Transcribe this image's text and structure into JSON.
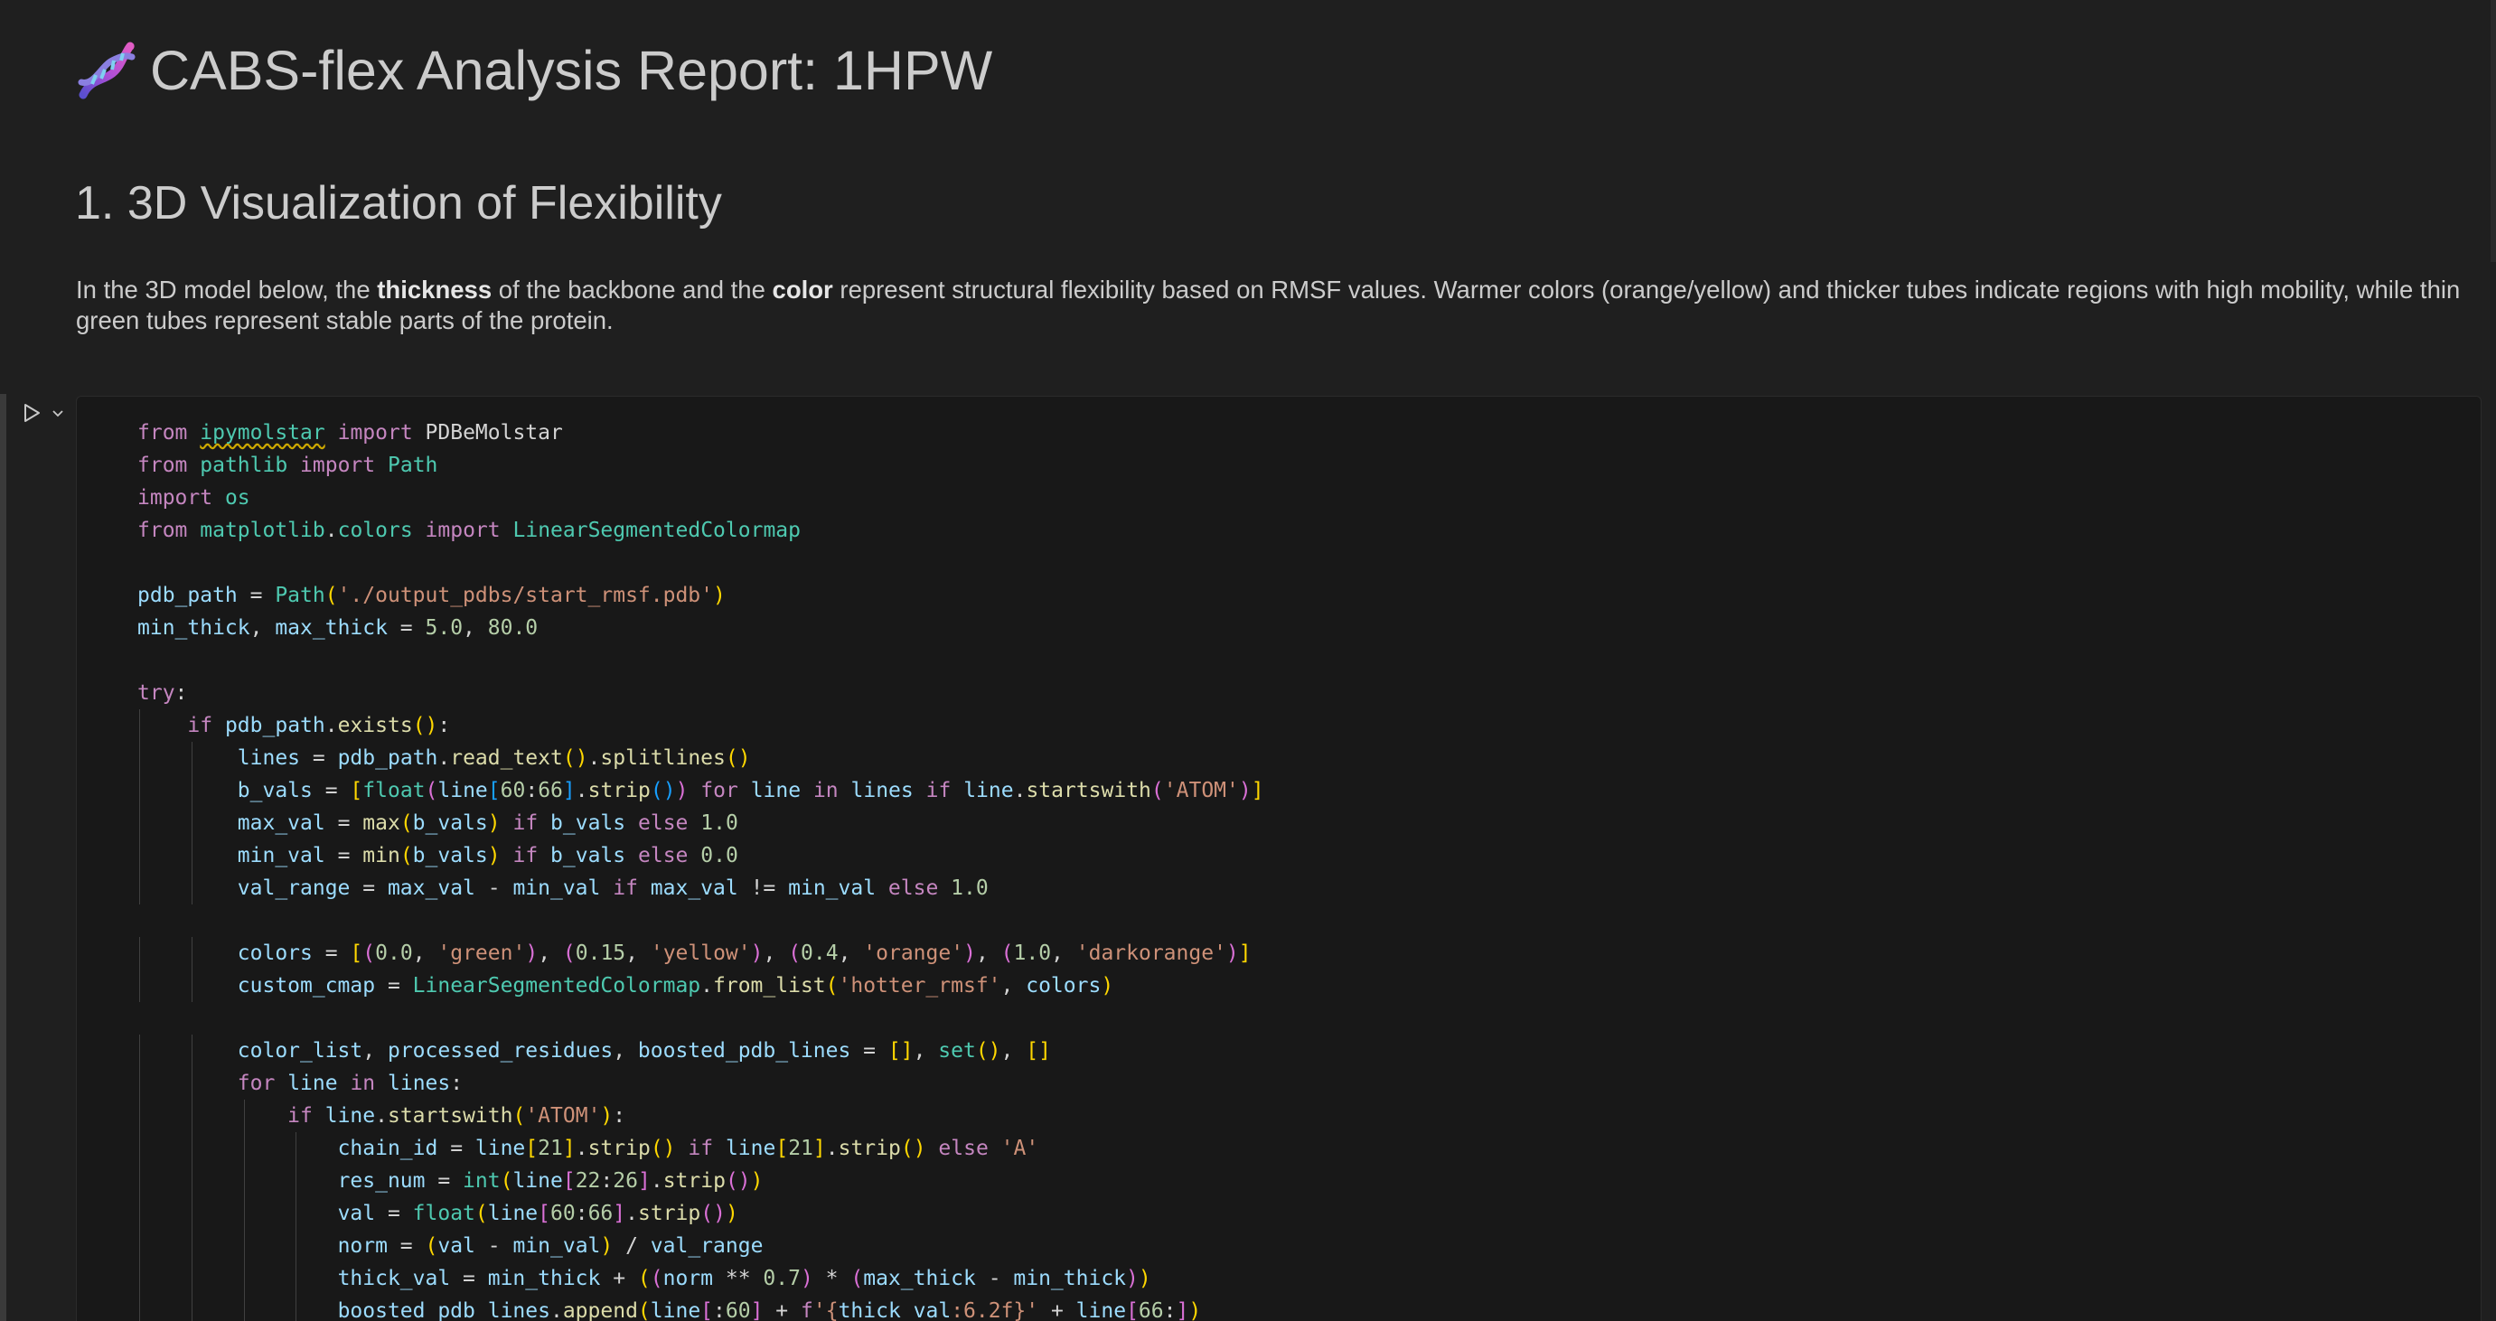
{
  "report": {
    "title": "CABS-flex Analysis Report: 1HPW",
    "title_icon": "dna-icon"
  },
  "section": {
    "title": "1. 3D Visualization of Flexibility",
    "paragraph": {
      "p1": "In the 3D model below, the ",
      "b1": "thickness",
      "p2": " of the backbone and the ",
      "b2": "color",
      "p3": " represent structural flexibility based on RMSF values. Warmer colors (orange/yellow) and thicker tubes indicate regions with high mobility, while thin green tubes represent stable parts of the protein."
    }
  },
  "cell": {
    "run_icon": "run-cell-icon",
    "expand_icon": "chevron-down-icon",
    "code_lines": [
      [
        [
          "kw",
          "from"
        ],
        [
          "op",
          " "
        ],
        [
          "mod sq",
          "ipymolstar"
        ],
        [
          "op",
          " "
        ],
        [
          "kw",
          "import"
        ],
        [
          "op",
          " PDBeMolstar"
        ]
      ],
      [
        [
          "kw",
          "from"
        ],
        [
          "op",
          " "
        ],
        [
          "mod",
          "pathlib"
        ],
        [
          "op",
          " "
        ],
        [
          "kw",
          "import"
        ],
        [
          "op",
          " "
        ],
        [
          "mod",
          "Path"
        ]
      ],
      [
        [
          "kw",
          "import"
        ],
        [
          "op",
          " "
        ],
        [
          "mod",
          "os"
        ]
      ],
      [
        [
          "kw",
          "from"
        ],
        [
          "op",
          " "
        ],
        [
          "mod",
          "matplotlib"
        ],
        [
          "op",
          "."
        ],
        [
          "mod",
          "colors"
        ],
        [
          "op",
          " "
        ],
        [
          "kw",
          "import"
        ],
        [
          "op",
          " "
        ],
        [
          "mod",
          "LinearSegmentedColormap"
        ]
      ],
      [],
      [
        [
          "var",
          "pdb_path"
        ],
        [
          "op",
          " = "
        ],
        [
          "mod",
          "Path"
        ],
        [
          "br1",
          "("
        ],
        [
          "str",
          "'./output_pdbs/start_rmsf.pdb'"
        ],
        [
          "br1",
          ")"
        ]
      ],
      [
        [
          "var",
          "min_thick"
        ],
        [
          "op",
          ", "
        ],
        [
          "var",
          "max_thick"
        ],
        [
          "op",
          " = "
        ],
        [
          "num",
          "5.0"
        ],
        [
          "op",
          ", "
        ],
        [
          "num",
          "80.0"
        ]
      ],
      [],
      [
        [
          "kw",
          "try"
        ],
        [
          "op",
          ":"
        ]
      ],
      [
        [
          "op",
          "    "
        ],
        [
          "kw",
          "if"
        ],
        [
          "op",
          " "
        ],
        [
          "var",
          "pdb_path"
        ],
        [
          "op",
          "."
        ],
        [
          "fn",
          "exists"
        ],
        [
          "br1",
          "()"
        ],
        [
          "op",
          ":"
        ]
      ],
      [
        [
          "op",
          "        "
        ],
        [
          "var",
          "lines"
        ],
        [
          "op",
          " = "
        ],
        [
          "var",
          "pdb_path"
        ],
        [
          "op",
          "."
        ],
        [
          "fn",
          "read_text"
        ],
        [
          "br1",
          "()"
        ],
        [
          "op",
          "."
        ],
        [
          "fn",
          "splitlines"
        ],
        [
          "br1",
          "()"
        ]
      ],
      [
        [
          "op",
          "        "
        ],
        [
          "var",
          "b_vals"
        ],
        [
          "op",
          " = "
        ],
        [
          "br1",
          "["
        ],
        [
          "mod",
          "float"
        ],
        [
          "br2",
          "("
        ],
        [
          "var",
          "line"
        ],
        [
          "br3",
          "["
        ],
        [
          "num",
          "60"
        ],
        [
          "op",
          ":"
        ],
        [
          "num",
          "66"
        ],
        [
          "br3",
          "]"
        ],
        [
          "op",
          "."
        ],
        [
          "fn",
          "strip"
        ],
        [
          "br3",
          "()"
        ],
        [
          "br2",
          ")"
        ],
        [
          "op",
          " "
        ],
        [
          "kw",
          "for"
        ],
        [
          "op",
          " "
        ],
        [
          "var",
          "line"
        ],
        [
          "op",
          " "
        ],
        [
          "kw",
          "in"
        ],
        [
          "op",
          " "
        ],
        [
          "var",
          "lines"
        ],
        [
          "op",
          " "
        ],
        [
          "kw",
          "if"
        ],
        [
          "op",
          " "
        ],
        [
          "var",
          "line"
        ],
        [
          "op",
          "."
        ],
        [
          "fn",
          "startswith"
        ],
        [
          "br2",
          "("
        ],
        [
          "str",
          "'ATOM'"
        ],
        [
          "br2",
          ")"
        ],
        [
          "br1",
          "]"
        ]
      ],
      [
        [
          "op",
          "        "
        ],
        [
          "var",
          "max_val"
        ],
        [
          "op",
          " = "
        ],
        [
          "fn",
          "max"
        ],
        [
          "br1",
          "("
        ],
        [
          "var",
          "b_vals"
        ],
        [
          "br1",
          ")"
        ],
        [
          "op",
          " "
        ],
        [
          "kw",
          "if"
        ],
        [
          "op",
          " "
        ],
        [
          "var",
          "b_vals"
        ],
        [
          "op",
          " "
        ],
        [
          "kw",
          "else"
        ],
        [
          "op",
          " "
        ],
        [
          "num",
          "1.0"
        ]
      ],
      [
        [
          "op",
          "        "
        ],
        [
          "var",
          "min_val"
        ],
        [
          "op",
          " = "
        ],
        [
          "fn",
          "min"
        ],
        [
          "br1",
          "("
        ],
        [
          "var",
          "b_vals"
        ],
        [
          "br1",
          ")"
        ],
        [
          "op",
          " "
        ],
        [
          "kw",
          "if"
        ],
        [
          "op",
          " "
        ],
        [
          "var",
          "b_vals"
        ],
        [
          "op",
          " "
        ],
        [
          "kw",
          "else"
        ],
        [
          "op",
          " "
        ],
        [
          "num",
          "0.0"
        ]
      ],
      [
        [
          "op",
          "        "
        ],
        [
          "var",
          "val_range"
        ],
        [
          "op",
          " = "
        ],
        [
          "var",
          "max_val"
        ],
        [
          "op",
          " - "
        ],
        [
          "var",
          "min_val"
        ],
        [
          "op",
          " "
        ],
        [
          "kw",
          "if"
        ],
        [
          "op",
          " "
        ],
        [
          "var",
          "max_val"
        ],
        [
          "op",
          " != "
        ],
        [
          "var",
          "min_val"
        ],
        [
          "op",
          " "
        ],
        [
          "kw",
          "else"
        ],
        [
          "op",
          " "
        ],
        [
          "num",
          "1.0"
        ]
      ],
      [],
      [
        [
          "op",
          "        "
        ],
        [
          "var",
          "colors"
        ],
        [
          "op",
          " = "
        ],
        [
          "br1",
          "["
        ],
        [
          "br2",
          "("
        ],
        [
          "num",
          "0.0"
        ],
        [
          "op",
          ", "
        ],
        [
          "str",
          "'green'"
        ],
        [
          "br2",
          ")"
        ],
        [
          "op",
          ", "
        ],
        [
          "br2",
          "("
        ],
        [
          "num",
          "0.15"
        ],
        [
          "op",
          ", "
        ],
        [
          "str",
          "'yellow'"
        ],
        [
          "br2",
          ")"
        ],
        [
          "op",
          ", "
        ],
        [
          "br2",
          "("
        ],
        [
          "num",
          "0.4"
        ],
        [
          "op",
          ", "
        ],
        [
          "str",
          "'orange'"
        ],
        [
          "br2",
          ")"
        ],
        [
          "op",
          ", "
        ],
        [
          "br2",
          "("
        ],
        [
          "num",
          "1.0"
        ],
        [
          "op",
          ", "
        ],
        [
          "str",
          "'darkorange'"
        ],
        [
          "br2",
          ")"
        ],
        [
          "br1",
          "]"
        ]
      ],
      [
        [
          "op",
          "        "
        ],
        [
          "var",
          "custom_cmap"
        ],
        [
          "op",
          " = "
        ],
        [
          "mod",
          "LinearSegmentedColormap"
        ],
        [
          "op",
          "."
        ],
        [
          "fn",
          "from_list"
        ],
        [
          "br1",
          "("
        ],
        [
          "str",
          "'hotter_rmsf'"
        ],
        [
          "op",
          ", "
        ],
        [
          "var",
          "colors"
        ],
        [
          "br1",
          ")"
        ]
      ],
      [],
      [
        [
          "op",
          "        "
        ],
        [
          "var",
          "color_list"
        ],
        [
          "op",
          ", "
        ],
        [
          "var",
          "processed_residues"
        ],
        [
          "op",
          ", "
        ],
        [
          "var",
          "boosted_pdb_lines"
        ],
        [
          "op",
          " = "
        ],
        [
          "br1",
          "[]"
        ],
        [
          "op",
          ", "
        ],
        [
          "mod",
          "set"
        ],
        [
          "br1",
          "()"
        ],
        [
          "op",
          ", "
        ],
        [
          "br1",
          "[]"
        ]
      ],
      [
        [
          "op",
          "        "
        ],
        [
          "kw",
          "for"
        ],
        [
          "op",
          " "
        ],
        [
          "var",
          "line"
        ],
        [
          "op",
          " "
        ],
        [
          "kw",
          "in"
        ],
        [
          "op",
          " "
        ],
        [
          "var",
          "lines"
        ],
        [
          "op",
          ":"
        ]
      ],
      [
        [
          "op",
          "            "
        ],
        [
          "kw",
          "if"
        ],
        [
          "op",
          " "
        ],
        [
          "var",
          "line"
        ],
        [
          "op",
          "."
        ],
        [
          "fn",
          "startswith"
        ],
        [
          "br1",
          "("
        ],
        [
          "str",
          "'ATOM'"
        ],
        [
          "br1",
          ")"
        ],
        [
          "op",
          ":"
        ]
      ],
      [
        [
          "op",
          "                "
        ],
        [
          "var",
          "chain_id"
        ],
        [
          "op",
          " = "
        ],
        [
          "var",
          "line"
        ],
        [
          "br1",
          "["
        ],
        [
          "num",
          "21"
        ],
        [
          "br1",
          "]"
        ],
        [
          "op",
          "."
        ],
        [
          "fn",
          "strip"
        ],
        [
          "br1",
          "()"
        ],
        [
          "op",
          " "
        ],
        [
          "kw",
          "if"
        ],
        [
          "op",
          " "
        ],
        [
          "var",
          "line"
        ],
        [
          "br1",
          "["
        ],
        [
          "num",
          "21"
        ],
        [
          "br1",
          "]"
        ],
        [
          "op",
          "."
        ],
        [
          "fn",
          "strip"
        ],
        [
          "br1",
          "()"
        ],
        [
          "op",
          " "
        ],
        [
          "kw",
          "else"
        ],
        [
          "op",
          " "
        ],
        [
          "str",
          "'A'"
        ]
      ],
      [
        [
          "op",
          "                "
        ],
        [
          "var",
          "res_num"
        ],
        [
          "op",
          " = "
        ],
        [
          "mod",
          "int"
        ],
        [
          "br1",
          "("
        ],
        [
          "var",
          "line"
        ],
        [
          "br2",
          "["
        ],
        [
          "num",
          "22"
        ],
        [
          "op",
          ":"
        ],
        [
          "num",
          "26"
        ],
        [
          "br2",
          "]"
        ],
        [
          "op",
          "."
        ],
        [
          "fn",
          "strip"
        ],
        [
          "br2",
          "()"
        ],
        [
          "br1",
          ")"
        ]
      ],
      [
        [
          "op",
          "                "
        ],
        [
          "var",
          "val"
        ],
        [
          "op",
          " = "
        ],
        [
          "mod",
          "float"
        ],
        [
          "br1",
          "("
        ],
        [
          "var",
          "line"
        ],
        [
          "br2",
          "["
        ],
        [
          "num",
          "60"
        ],
        [
          "op",
          ":"
        ],
        [
          "num",
          "66"
        ],
        [
          "br2",
          "]"
        ],
        [
          "op",
          "."
        ],
        [
          "fn",
          "strip"
        ],
        [
          "br2",
          "()"
        ],
        [
          "br1",
          ")"
        ]
      ],
      [
        [
          "op",
          "                "
        ],
        [
          "var",
          "norm"
        ],
        [
          "op",
          " = "
        ],
        [
          "br1",
          "("
        ],
        [
          "var",
          "val"
        ],
        [
          "op",
          " - "
        ],
        [
          "var",
          "min_val"
        ],
        [
          "br1",
          ")"
        ],
        [
          "op",
          " / "
        ],
        [
          "var",
          "val_range"
        ]
      ],
      [
        [
          "op",
          "                "
        ],
        [
          "var",
          "thick_val"
        ],
        [
          "op",
          " = "
        ],
        [
          "var",
          "min_thick"
        ],
        [
          "op",
          " + "
        ],
        [
          "br1",
          "("
        ],
        [
          "br2",
          "("
        ],
        [
          "var",
          "norm"
        ],
        [
          "op",
          " ** "
        ],
        [
          "num",
          "0.7"
        ],
        [
          "br2",
          ")"
        ],
        [
          "op",
          " * "
        ],
        [
          "br2",
          "("
        ],
        [
          "var",
          "max_thick"
        ],
        [
          "op",
          " - "
        ],
        [
          "var",
          "min_thick"
        ],
        [
          "br2",
          ")"
        ],
        [
          "br1",
          ")"
        ]
      ],
      [
        [
          "op",
          "                "
        ],
        [
          "var",
          "boosted_pdb_lines"
        ],
        [
          "op",
          "."
        ],
        [
          "fn",
          "append"
        ],
        [
          "br1",
          "("
        ],
        [
          "var",
          "line"
        ],
        [
          "br2",
          "["
        ],
        [
          "op",
          ":"
        ],
        [
          "num",
          "60"
        ],
        [
          "br2",
          "]"
        ],
        [
          "op",
          " + "
        ],
        [
          "kw",
          "f"
        ],
        [
          "str",
          "'{"
        ],
        [
          "var",
          "thick_val"
        ],
        [
          "str",
          ":6.2f}'"
        ],
        [
          "op",
          " + "
        ],
        [
          "var",
          "line"
        ],
        [
          "br2",
          "["
        ],
        [
          "num",
          "66"
        ],
        [
          "op",
          ":"
        ],
        [
          "br2",
          "]"
        ],
        [
          "br1",
          ")"
        ]
      ]
    ]
  }
}
